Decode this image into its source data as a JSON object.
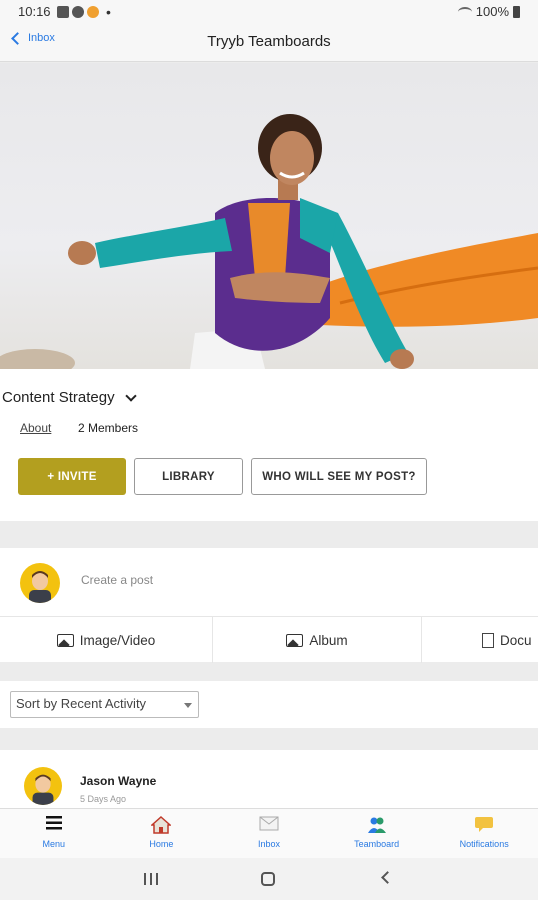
{
  "status_bar": {
    "time": "10:16",
    "battery": "100%"
  },
  "nav": {
    "back_label": "Inbox",
    "title": "Tryyb Teamboards"
  },
  "group": {
    "name": "Content Strategy",
    "about_link": "About",
    "members": "2 Members",
    "buttons": {
      "invite": "+ INVITE",
      "library": "LIBRARY",
      "who": "WHO WILL SEE MY POST?"
    }
  },
  "composer": {
    "placeholder": "Create a post",
    "media": [
      "Image/Video",
      "Album",
      "Docu"
    ]
  },
  "sort": {
    "selected": "Sort by Recent Activity"
  },
  "feed": [
    {
      "author": "Jason Wayne",
      "time": "5 Days Ago"
    }
  ],
  "tabs": [
    {
      "label": "Menu",
      "icon": "menu-icon"
    },
    {
      "label": "Home",
      "icon": "home-icon"
    },
    {
      "label": "Inbox",
      "icon": "inbox-icon"
    },
    {
      "label": "Teamboard",
      "icon": "teamboard-icon"
    },
    {
      "label": "Notifications",
      "icon": "notifications-icon"
    }
  ],
  "colors": {
    "accent_blue": "#2a7ae2",
    "invite_gold": "#b39f1f",
    "avatar_yellow": "#f3c20f"
  }
}
